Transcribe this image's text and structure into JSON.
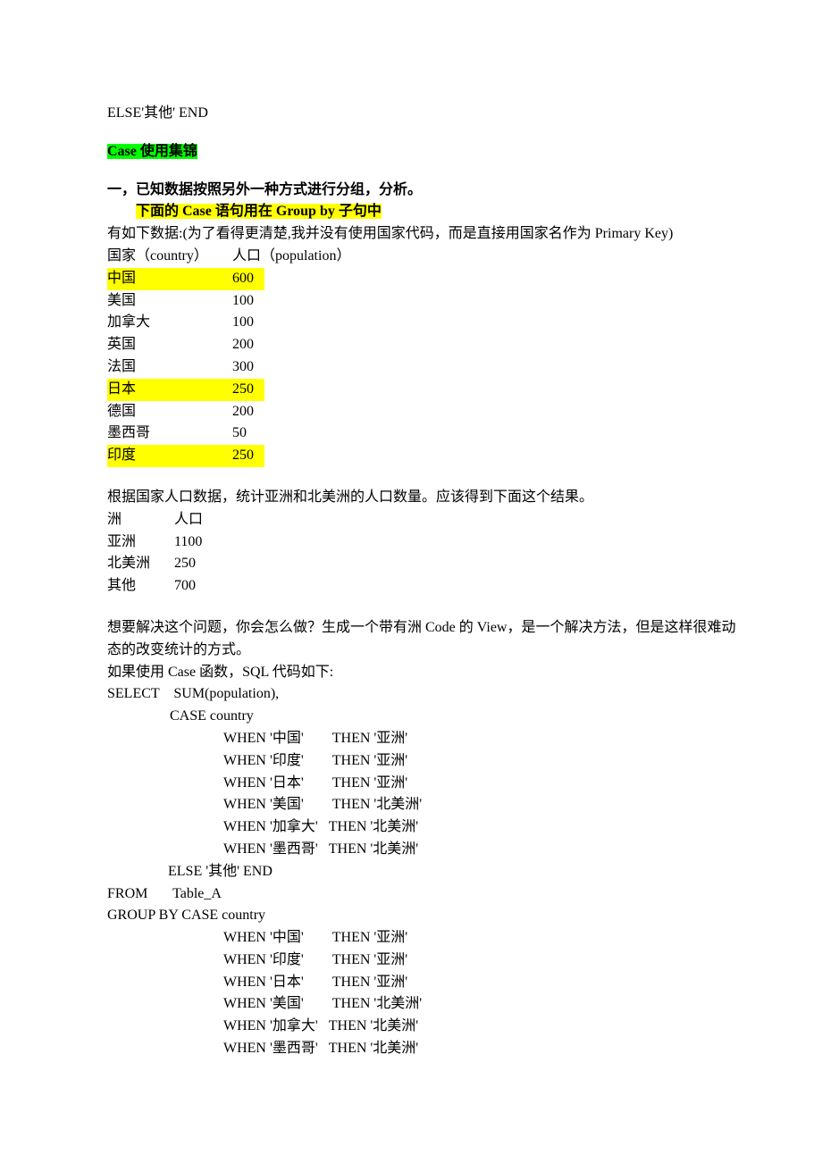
{
  "header_line": "ELSE'其他' END",
  "section_title": "Case 使用集锦",
  "subtitle_1": "一，已知数据按照另外一种方式进行分组，分析。",
  "subtitle_2": "下面的 Case 语句用在 Group by 子句中",
  "intro_text": "有如下数据:(为了看得更清楚,我并没有使用国家代码，而是直接用国家名作为 Primary Key)",
  "table_header": {
    "country": "国家（country）",
    "population": "人口（population）"
  },
  "countries": [
    {
      "name": "中国",
      "pop": "600",
      "hl": true
    },
    {
      "name": "美国",
      "pop": "100",
      "hl": false
    },
    {
      "name": "加拿大",
      "pop": "100",
      "hl": false
    },
    {
      "name": "英国",
      "pop": "200",
      "hl": false
    },
    {
      "name": "法国",
      "pop": "300",
      "hl": false
    },
    {
      "name": "日本",
      "pop": "250",
      "hl": true
    },
    {
      "name": "德国",
      "pop": "200",
      "hl": false
    },
    {
      "name": "墨西哥",
      "pop": "50",
      "hl": false
    },
    {
      "name": "印度",
      "pop": "250",
      "hl": true
    }
  ],
  "result_intro": "根据国家人口数据，统计亚洲和北美洲的人口数量。应该得到下面这个结果。",
  "result_header": {
    "continent": "洲",
    "population": "人口"
  },
  "results": [
    {
      "name": "亚洲",
      "pop": "1100"
    },
    {
      "name": "北美洲",
      "pop": "250"
    },
    {
      "name": "其他",
      "pop": "700"
    }
  ],
  "explain_1": "想要解决这个问题，你会怎么做？生成一个带有洲 Code 的 View，是一个解决方法，但是这样很难动态的改变统计的方式。",
  "explain_2": "如果使用 Case 函数，SQL 代码如下:",
  "sql": {
    "l1": "SELECT    SUM(population),",
    "l2": "CASE country",
    "w1": "WHEN '中国'        THEN '亚洲'",
    "w2": "WHEN '印度'        THEN '亚洲'",
    "w3": "WHEN '日本'        THEN '亚洲'",
    "w4": "WHEN '美国'        THEN '北美洲'",
    "w5": "WHEN '加拿大'   THEN '北美洲'",
    "w6": "WHEN '墨西哥'   THEN '北美洲'",
    "l3": "ELSE '其他' END",
    "l4": "FROM       Table_A",
    "l5": "GROUP BY CASE country",
    "w7": "WHEN '中国'        THEN '亚洲'",
    "w8": "WHEN '印度'        THEN '亚洲'",
    "w9": "WHEN '日本'        THEN '亚洲'",
    "w10": "WHEN '美国'        THEN '北美洲'",
    "w11": "WHEN '加拿大'   THEN '北美洲'",
    "w12": "WHEN '墨西哥'   THEN '北美洲'"
  }
}
